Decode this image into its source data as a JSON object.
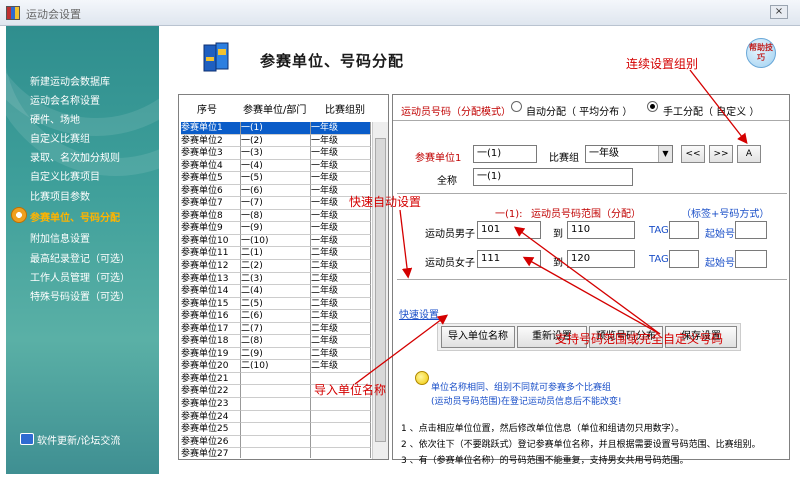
{
  "window": {
    "title": "运动会设置",
    "close_label": "×"
  },
  "sidebar": {
    "items": [
      {
        "label": "新建运动会数据库"
      },
      {
        "label": "运动会名称设置"
      },
      {
        "label": "硬件、场地"
      },
      {
        "label": "自定义比赛组"
      },
      {
        "label": "录取、名次加分规则"
      },
      {
        "label": "自定义比赛项目"
      },
      {
        "label": "比赛项目参数"
      },
      {
        "label": "参赛单位、号码分配"
      },
      {
        "label": "附加信息设置"
      },
      {
        "label": "最高纪录登记（可选）"
      },
      {
        "label": "工作人员管理（可选）"
      },
      {
        "label": "特殊号码设置（可选）"
      }
    ],
    "footer": "软件更新/论坛交流"
  },
  "header": {
    "title": "参赛单位、号码分配",
    "help": "帮助技巧"
  },
  "list": {
    "headers": [
      "序号",
      "参赛单位/部门",
      "比赛组别"
    ],
    "rows": [
      [
        "参赛单位1",
        "一(1)",
        "一年级"
      ],
      [
        "参赛单位2",
        "一(2)",
        "一年级"
      ],
      [
        "参赛单位3",
        "一(3)",
        "一年级"
      ],
      [
        "参赛单位4",
        "一(4)",
        "一年级"
      ],
      [
        "参赛单位5",
        "一(5)",
        "一年级"
      ],
      [
        "参赛单位6",
        "一(6)",
        "一年级"
      ],
      [
        "参赛单位7",
        "一(7)",
        "一年级"
      ],
      [
        "参赛单位8",
        "一(8)",
        "一年级"
      ],
      [
        "参赛单位9",
        "一(9)",
        "一年级"
      ],
      [
        "参赛单位10",
        "一(10)",
        "一年级"
      ],
      [
        "参赛单位11",
        "二(1)",
        "二年级"
      ],
      [
        "参赛单位12",
        "二(2)",
        "二年级"
      ],
      [
        "参赛单位13",
        "二(3)",
        "二年级"
      ],
      [
        "参赛单位14",
        "二(4)",
        "二年级"
      ],
      [
        "参赛单位15",
        "二(5)",
        "二年级"
      ],
      [
        "参赛单位16",
        "二(6)",
        "二年级"
      ],
      [
        "参赛单位17",
        "二(7)",
        "二年级"
      ],
      [
        "参赛单位18",
        "二(8)",
        "二年级"
      ],
      [
        "参赛单位19",
        "二(9)",
        "二年级"
      ],
      [
        "参赛单位20",
        "二(10)",
        "二年级"
      ],
      [
        "参赛单位21",
        "",
        ""
      ],
      [
        "参赛单位22",
        "",
        ""
      ],
      [
        "参赛单位23",
        "",
        ""
      ],
      [
        "参赛单位24",
        "",
        ""
      ],
      [
        "参赛单位25",
        "",
        ""
      ],
      [
        "参赛单位26",
        "",
        ""
      ],
      [
        "参赛单位27",
        "",
        ""
      ]
    ]
  },
  "mode": {
    "label": "运动员号码（分配模式）",
    "auto": "自动分配（ 平均分布 ）",
    "manual": "手工分配（ 自定义 ）"
  },
  "unit": {
    "label": "参赛单位1",
    "value": "一(1)",
    "group_label": "比赛组",
    "group_value": "一年级",
    "fullname_label": "全称",
    "fullname_value": "一(1)",
    "nav": [
      "<<",
      ">>",
      "A"
    ]
  },
  "range": {
    "unit": "一(1):",
    "title": "运动员号码范围（分配）",
    "tag_title": "（标签+号码方式）",
    "male_label": "运动员男子",
    "male_from": "101",
    "male_to": "110",
    "female_label": "运动员女子",
    "female_from": "111",
    "female_to": "120",
    "to_label": "到",
    "tag_label": "TAG",
    "start_label": "起始号"
  },
  "quick": {
    "link": "快速设置",
    "buttons": [
      "导入单位名称",
      "重新设置",
      "预览号码分布",
      "保存设置"
    ]
  },
  "notes": {
    "line1": "单位名称相同、组别不同就可参赛多个比赛组",
    "line2": "(运动员号码范围)在登记运动员信息后不能改变!",
    "steps": [
      "1 、点击相应单位位置，然后修改单位信息（单位和组请勿只用数字）。",
      "2 、依次往下（不要跳跃式）登记参赛单位名称，并且根据需要设置号码范围、比赛组别。",
      "3 、有（参赛单位名称）的号码范围不能重复，支持男女共用号码范围。"
    ]
  },
  "annotations": {
    "continuous": "连续设置组别",
    "quick": "快速自动设置",
    "custom": "支持号码范围或完全自定义号码",
    "import": "导入单位名称"
  },
  "colors": {
    "annotation": "#d40000",
    "selection": "#0a5cc8",
    "sidebar": "#3e9f9a"
  }
}
